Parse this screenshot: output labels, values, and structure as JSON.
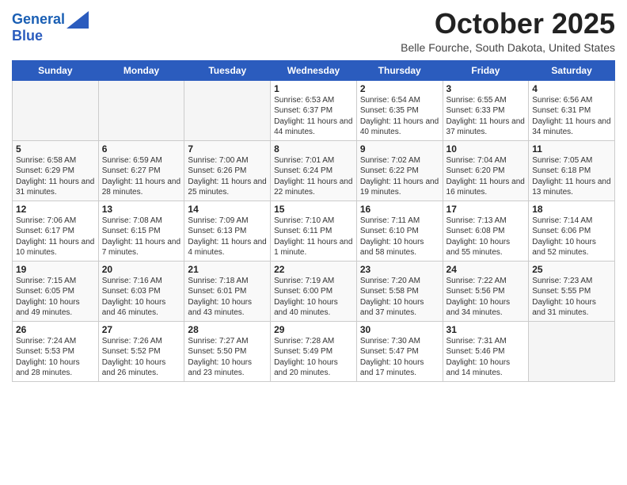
{
  "logo": {
    "line1": "General",
    "line2": "Blue"
  },
  "title": "October 2025",
  "subtitle": "Belle Fourche, South Dakota, United States",
  "days_of_week": [
    "Sunday",
    "Monday",
    "Tuesday",
    "Wednesday",
    "Thursday",
    "Friday",
    "Saturday"
  ],
  "weeks": [
    [
      {
        "num": "",
        "info": ""
      },
      {
        "num": "",
        "info": ""
      },
      {
        "num": "",
        "info": ""
      },
      {
        "num": "1",
        "info": "Sunrise: 6:53 AM\nSunset: 6:37 PM\nDaylight: 11 hours\nand 44 minutes."
      },
      {
        "num": "2",
        "info": "Sunrise: 6:54 AM\nSunset: 6:35 PM\nDaylight: 11 hours\nand 40 minutes."
      },
      {
        "num": "3",
        "info": "Sunrise: 6:55 AM\nSunset: 6:33 PM\nDaylight: 11 hours\nand 37 minutes."
      },
      {
        "num": "4",
        "info": "Sunrise: 6:56 AM\nSunset: 6:31 PM\nDaylight: 11 hours\nand 34 minutes."
      }
    ],
    [
      {
        "num": "5",
        "info": "Sunrise: 6:58 AM\nSunset: 6:29 PM\nDaylight: 11 hours\nand 31 minutes."
      },
      {
        "num": "6",
        "info": "Sunrise: 6:59 AM\nSunset: 6:27 PM\nDaylight: 11 hours\nand 28 minutes."
      },
      {
        "num": "7",
        "info": "Sunrise: 7:00 AM\nSunset: 6:26 PM\nDaylight: 11 hours\nand 25 minutes."
      },
      {
        "num": "8",
        "info": "Sunrise: 7:01 AM\nSunset: 6:24 PM\nDaylight: 11 hours\nand 22 minutes."
      },
      {
        "num": "9",
        "info": "Sunrise: 7:02 AM\nSunset: 6:22 PM\nDaylight: 11 hours\nand 19 minutes."
      },
      {
        "num": "10",
        "info": "Sunrise: 7:04 AM\nSunset: 6:20 PM\nDaylight: 11 hours\nand 16 minutes."
      },
      {
        "num": "11",
        "info": "Sunrise: 7:05 AM\nSunset: 6:18 PM\nDaylight: 11 hours\nand 13 minutes."
      }
    ],
    [
      {
        "num": "12",
        "info": "Sunrise: 7:06 AM\nSunset: 6:17 PM\nDaylight: 11 hours\nand 10 minutes."
      },
      {
        "num": "13",
        "info": "Sunrise: 7:08 AM\nSunset: 6:15 PM\nDaylight: 11 hours\nand 7 minutes."
      },
      {
        "num": "14",
        "info": "Sunrise: 7:09 AM\nSunset: 6:13 PM\nDaylight: 11 hours\nand 4 minutes."
      },
      {
        "num": "15",
        "info": "Sunrise: 7:10 AM\nSunset: 6:11 PM\nDaylight: 11 hours\nand 1 minute."
      },
      {
        "num": "16",
        "info": "Sunrise: 7:11 AM\nSunset: 6:10 PM\nDaylight: 10 hours\nand 58 minutes."
      },
      {
        "num": "17",
        "info": "Sunrise: 7:13 AM\nSunset: 6:08 PM\nDaylight: 10 hours\nand 55 minutes."
      },
      {
        "num": "18",
        "info": "Sunrise: 7:14 AM\nSunset: 6:06 PM\nDaylight: 10 hours\nand 52 minutes."
      }
    ],
    [
      {
        "num": "19",
        "info": "Sunrise: 7:15 AM\nSunset: 6:05 PM\nDaylight: 10 hours\nand 49 minutes."
      },
      {
        "num": "20",
        "info": "Sunrise: 7:16 AM\nSunset: 6:03 PM\nDaylight: 10 hours\nand 46 minutes."
      },
      {
        "num": "21",
        "info": "Sunrise: 7:18 AM\nSunset: 6:01 PM\nDaylight: 10 hours\nand 43 minutes."
      },
      {
        "num": "22",
        "info": "Sunrise: 7:19 AM\nSunset: 6:00 PM\nDaylight: 10 hours\nand 40 minutes."
      },
      {
        "num": "23",
        "info": "Sunrise: 7:20 AM\nSunset: 5:58 PM\nDaylight: 10 hours\nand 37 minutes."
      },
      {
        "num": "24",
        "info": "Sunrise: 7:22 AM\nSunset: 5:56 PM\nDaylight: 10 hours\nand 34 minutes."
      },
      {
        "num": "25",
        "info": "Sunrise: 7:23 AM\nSunset: 5:55 PM\nDaylight: 10 hours\nand 31 minutes."
      }
    ],
    [
      {
        "num": "26",
        "info": "Sunrise: 7:24 AM\nSunset: 5:53 PM\nDaylight: 10 hours\nand 28 minutes."
      },
      {
        "num": "27",
        "info": "Sunrise: 7:26 AM\nSunset: 5:52 PM\nDaylight: 10 hours\nand 26 minutes."
      },
      {
        "num": "28",
        "info": "Sunrise: 7:27 AM\nSunset: 5:50 PM\nDaylight: 10 hours\nand 23 minutes."
      },
      {
        "num": "29",
        "info": "Sunrise: 7:28 AM\nSunset: 5:49 PM\nDaylight: 10 hours\nand 20 minutes."
      },
      {
        "num": "30",
        "info": "Sunrise: 7:30 AM\nSunset: 5:47 PM\nDaylight: 10 hours\nand 17 minutes."
      },
      {
        "num": "31",
        "info": "Sunrise: 7:31 AM\nSunset: 5:46 PM\nDaylight: 10 hours\nand 14 minutes."
      },
      {
        "num": "",
        "info": ""
      }
    ]
  ]
}
